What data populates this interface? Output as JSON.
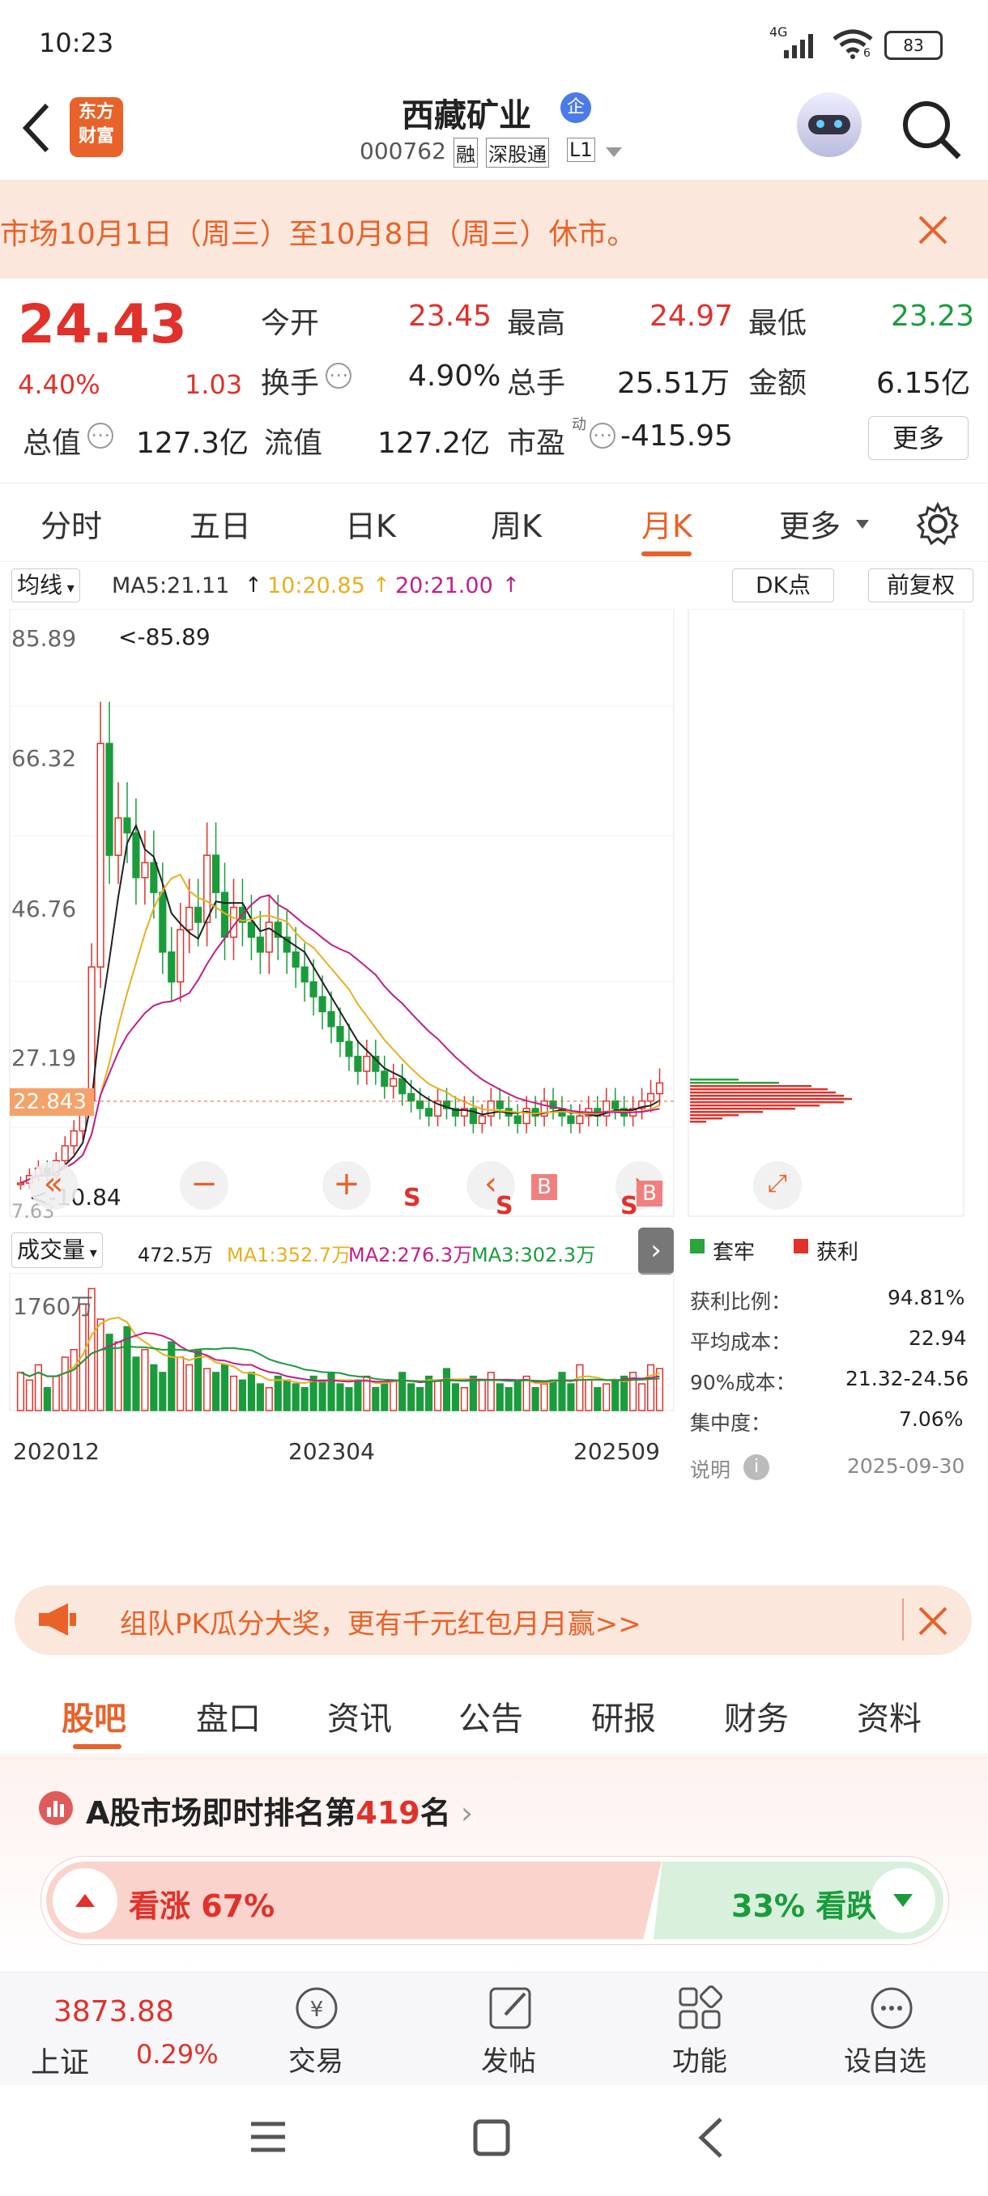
{
  "status": {
    "time": "10:23",
    "network": "4G",
    "wifi_sub": "6",
    "battery": "83"
  },
  "header": {
    "title": "西藏矿业",
    "badge": "企",
    "code": "000762",
    "tags": [
      "融",
      "深股通",
      "L1"
    ],
    "logo_text": [
      "东方",
      "财富"
    ]
  },
  "notice": {
    "text": "市场10月1日（周三）至10月8日（周三）休市。"
  },
  "quote": {
    "price": "24.43",
    "change_pct": "4.40%",
    "change": "1.03",
    "fields": [
      {
        "label": "今开",
        "value": "23.45",
        "color": "red"
      },
      {
        "label": "最高",
        "value": "24.97",
        "color": "red"
      },
      {
        "label": "最低",
        "value": "23.23",
        "color": "green"
      },
      {
        "label": "换手",
        "value": "4.90%",
        "color": "dark"
      },
      {
        "label": "总手",
        "value": "25.51万",
        "color": "dark"
      },
      {
        "label": "金额",
        "value": "6.15亿",
        "color": "dark"
      },
      {
        "label": "总值",
        "value": "127.3亿",
        "color": "dark"
      },
      {
        "label": "流值",
        "value": "127.2亿",
        "color": "dark"
      },
      {
        "label": "市盈",
        "value": "-415.95",
        "color": "dark"
      }
    ],
    "pe_sup": "动",
    "more": "更多"
  },
  "tabs": [
    "分时",
    "五日",
    "日K",
    "周K",
    "月K",
    "更多"
  ],
  "active_tab": "月K",
  "kline": {
    "ma_selector": "均线",
    "ma5": "MA5:21.11",
    "ma10": "10:20.85",
    "ma20": "20:21.00",
    "dk": "DK点",
    "adjust": "前复权",
    "y_labels": [
      "85.89",
      "66.32",
      "46.76",
      "27.19"
    ],
    "current_tag": "22.843",
    "high_note": "<-85.89",
    "low_note": "<-10.84",
    "low_axis": "7.63",
    "markers": [
      "S",
      "S",
      "B",
      "S",
      "B"
    ]
  },
  "volume": {
    "selector": "成交量",
    "vol": "472.5万",
    "ma1": "MA1:352.7万",
    "ma2": "MA2:276.3万",
    "ma3": "MA3:302.3万",
    "top": "1760万",
    "dates": [
      "202012",
      "202304",
      "202509"
    ]
  },
  "chips": {
    "legend": [
      "套牢",
      "获利"
    ],
    "rows": [
      {
        "label": "获利比例：",
        "value": "94.81%"
      },
      {
        "label": "平均成本：",
        "value": "22.94"
      },
      {
        "label": "90%成本：",
        "value": "21.32-24.56"
      },
      {
        "label": "集中度：",
        "value": "7.06%"
      }
    ],
    "note": "说明",
    "date": "2025-09-30"
  },
  "promo": {
    "text": "组队PK瓜分大奖，更有千元红包月月赢>>"
  },
  "subtabs": [
    "股吧",
    "盘口",
    "资讯",
    "公告",
    "研报",
    "财务",
    "资料"
  ],
  "rank": {
    "prefix": "A股市场即时排名第",
    "num": "419",
    "suffix": "名",
    "up_label": "看涨",
    "up_pct": "67%",
    "down_pct": "33%",
    "down_label": "看跌"
  },
  "bottombar": {
    "index_value": "3873.88",
    "index_name": "上证",
    "index_pct": "0.29%",
    "items": [
      "交易",
      "发帖",
      "功能",
      "设自选"
    ]
  },
  "colors": {
    "up": "#e0312b",
    "down": "#1a9c3c",
    "accent": "#e8622a"
  }
}
